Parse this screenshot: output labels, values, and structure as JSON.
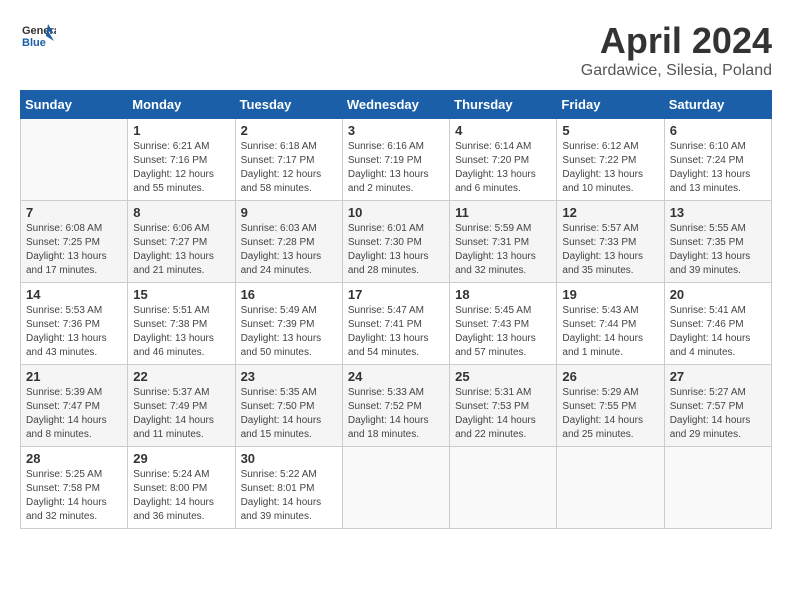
{
  "header": {
    "logo_line1": "General",
    "logo_line2": "Blue",
    "month_year": "April 2024",
    "location": "Gardawice, Silesia, Poland"
  },
  "weekdays": [
    "Sunday",
    "Monday",
    "Tuesday",
    "Wednesday",
    "Thursday",
    "Friday",
    "Saturday"
  ],
  "weeks": [
    [
      {
        "day": "",
        "sunrise": "",
        "sunset": "",
        "daylight": ""
      },
      {
        "day": "1",
        "sunrise": "6:21 AM",
        "sunset": "7:16 PM",
        "daylight": "12 hours and 55 minutes."
      },
      {
        "day": "2",
        "sunrise": "6:18 AM",
        "sunset": "7:17 PM",
        "daylight": "12 hours and 58 minutes."
      },
      {
        "day": "3",
        "sunrise": "6:16 AM",
        "sunset": "7:19 PM",
        "daylight": "13 hours and 2 minutes."
      },
      {
        "day": "4",
        "sunrise": "6:14 AM",
        "sunset": "7:20 PM",
        "daylight": "13 hours and 6 minutes."
      },
      {
        "day": "5",
        "sunrise": "6:12 AM",
        "sunset": "7:22 PM",
        "daylight": "13 hours and 10 minutes."
      },
      {
        "day": "6",
        "sunrise": "6:10 AM",
        "sunset": "7:24 PM",
        "daylight": "13 hours and 13 minutes."
      }
    ],
    [
      {
        "day": "7",
        "sunrise": "6:08 AM",
        "sunset": "7:25 PM",
        "daylight": "13 hours and 17 minutes."
      },
      {
        "day": "8",
        "sunrise": "6:06 AM",
        "sunset": "7:27 PM",
        "daylight": "13 hours and 21 minutes."
      },
      {
        "day": "9",
        "sunrise": "6:03 AM",
        "sunset": "7:28 PM",
        "daylight": "13 hours and 24 minutes."
      },
      {
        "day": "10",
        "sunrise": "6:01 AM",
        "sunset": "7:30 PM",
        "daylight": "13 hours and 28 minutes."
      },
      {
        "day": "11",
        "sunrise": "5:59 AM",
        "sunset": "7:31 PM",
        "daylight": "13 hours and 32 minutes."
      },
      {
        "day": "12",
        "sunrise": "5:57 AM",
        "sunset": "7:33 PM",
        "daylight": "13 hours and 35 minutes."
      },
      {
        "day": "13",
        "sunrise": "5:55 AM",
        "sunset": "7:35 PM",
        "daylight": "13 hours and 39 minutes."
      }
    ],
    [
      {
        "day": "14",
        "sunrise": "5:53 AM",
        "sunset": "7:36 PM",
        "daylight": "13 hours and 43 minutes."
      },
      {
        "day": "15",
        "sunrise": "5:51 AM",
        "sunset": "7:38 PM",
        "daylight": "13 hours and 46 minutes."
      },
      {
        "day": "16",
        "sunrise": "5:49 AM",
        "sunset": "7:39 PM",
        "daylight": "13 hours and 50 minutes."
      },
      {
        "day": "17",
        "sunrise": "5:47 AM",
        "sunset": "7:41 PM",
        "daylight": "13 hours and 54 minutes."
      },
      {
        "day": "18",
        "sunrise": "5:45 AM",
        "sunset": "7:43 PM",
        "daylight": "13 hours and 57 minutes."
      },
      {
        "day": "19",
        "sunrise": "5:43 AM",
        "sunset": "7:44 PM",
        "daylight": "14 hours and 1 minute."
      },
      {
        "day": "20",
        "sunrise": "5:41 AM",
        "sunset": "7:46 PM",
        "daylight": "14 hours and 4 minutes."
      }
    ],
    [
      {
        "day": "21",
        "sunrise": "5:39 AM",
        "sunset": "7:47 PM",
        "daylight": "14 hours and 8 minutes."
      },
      {
        "day": "22",
        "sunrise": "5:37 AM",
        "sunset": "7:49 PM",
        "daylight": "14 hours and 11 minutes."
      },
      {
        "day": "23",
        "sunrise": "5:35 AM",
        "sunset": "7:50 PM",
        "daylight": "14 hours and 15 minutes."
      },
      {
        "day": "24",
        "sunrise": "5:33 AM",
        "sunset": "7:52 PM",
        "daylight": "14 hours and 18 minutes."
      },
      {
        "day": "25",
        "sunrise": "5:31 AM",
        "sunset": "7:53 PM",
        "daylight": "14 hours and 22 minutes."
      },
      {
        "day": "26",
        "sunrise": "5:29 AM",
        "sunset": "7:55 PM",
        "daylight": "14 hours and 25 minutes."
      },
      {
        "day": "27",
        "sunrise": "5:27 AM",
        "sunset": "7:57 PM",
        "daylight": "14 hours and 29 minutes."
      }
    ],
    [
      {
        "day": "28",
        "sunrise": "5:25 AM",
        "sunset": "7:58 PM",
        "daylight": "14 hours and 32 minutes."
      },
      {
        "day": "29",
        "sunrise": "5:24 AM",
        "sunset": "8:00 PM",
        "daylight": "14 hours and 36 minutes."
      },
      {
        "day": "30",
        "sunrise": "5:22 AM",
        "sunset": "8:01 PM",
        "daylight": "14 hours and 39 minutes."
      },
      {
        "day": "",
        "sunrise": "",
        "sunset": "",
        "daylight": ""
      },
      {
        "day": "",
        "sunrise": "",
        "sunset": "",
        "daylight": ""
      },
      {
        "day": "",
        "sunrise": "",
        "sunset": "",
        "daylight": ""
      },
      {
        "day": "",
        "sunrise": "",
        "sunset": "",
        "daylight": ""
      }
    ]
  ]
}
